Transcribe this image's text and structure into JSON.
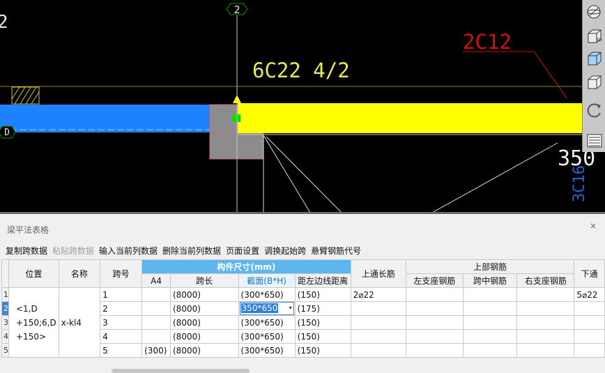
{
  "cad": {
    "axis_top_label": "2",
    "axis_left_label": "D",
    "edge_number": "2",
    "rebar_top": "6C22 4/2",
    "rebar_red": "2C12",
    "right_dim": "350",
    "right_vertical": "3C16",
    "colors": {
      "beam_blue": "#1e82ff",
      "beam_yellow": "#ffff00",
      "column_gray": "#8c8c8c",
      "node_green": "#00e000",
      "leader_red": "#d01010",
      "axis_green": "#009a00",
      "text_yellow": "#e8e85a",
      "text_blue": "#3060d0"
    }
  },
  "tools": {
    "icons": [
      "sphere-view-icon",
      "3d-box-icon",
      "box-view-icon",
      "box-outline-icon",
      "rotate-icon",
      "grid-panel-icon"
    ]
  },
  "panel": {
    "title": "梁平法表格",
    "close": "×",
    "toolbar": [
      {
        "label": "复制跨数据",
        "enabled": true
      },
      {
        "label": "粘贴跨数据",
        "enabled": false
      },
      {
        "label": "输入当前列数据",
        "enabled": true
      },
      {
        "label": "删除当前列数据",
        "enabled": true
      },
      {
        "label": "页面设置",
        "enabled": true
      },
      {
        "label": "调换起始跨",
        "enabled": true
      },
      {
        "label": "悬臂钢筋代号",
        "enabled": true
      }
    ],
    "headers": {
      "position": "位置",
      "name": "名称",
      "span_no": "跨号",
      "size_group": "构件尺寸(mm)",
      "a4": "A4",
      "span_len": "跨长",
      "section": "截面(B*H)",
      "left_dist": "距左边线距离",
      "top_long": "上通长筋",
      "top_group": "上部钢筋",
      "left_support": "左支座钢筋",
      "mid": "跨中钢筋",
      "right_support": "右支座钢筋",
      "bottom_cut": "下通"
    },
    "row_position": "<1,D +150;6,D +150>",
    "row_name": "x-kl4",
    "rows": [
      {
        "rn": "1",
        "span": "1",
        "a4": "",
        "len": "(8000)",
        "section": "(300*650)",
        "dist": "(150)",
        "top": "2⌀22",
        "bottom": "5⌀22"
      },
      {
        "rn": "2",
        "span": "2",
        "a4": "",
        "len": "(8000)",
        "section": "350*650",
        "dist": "(175)",
        "top": "",
        "bottom": ""
      },
      {
        "rn": "3",
        "span": "3",
        "a4": "",
        "len": "(8000)",
        "section": "(300*650)",
        "dist": "(150)",
        "top": "",
        "bottom": ""
      },
      {
        "rn": "4",
        "span": "4",
        "a4": "",
        "len": "(8000)",
        "section": "(300*650)",
        "dist": "(150)",
        "top": "",
        "bottom": ""
      },
      {
        "rn": "5",
        "span": "5",
        "a4": "(300)",
        "len": "(8000)",
        "section": "(300*650)",
        "dist": "(150)",
        "top": "",
        "bottom": ""
      }
    ],
    "dropdown_glyph": "▾"
  }
}
